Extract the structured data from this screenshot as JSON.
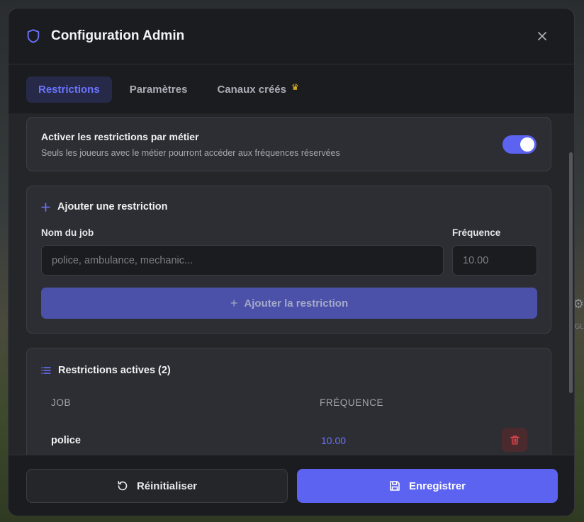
{
  "modal": {
    "title": "Configuration Admin",
    "icons": {
      "title": "shield-icon",
      "close": "close-icon"
    }
  },
  "tabs": [
    {
      "label": "Restrictions",
      "active": true
    },
    {
      "label": "Paramètres",
      "active": false
    },
    {
      "label": "Canaux créés",
      "active": false,
      "badge_icon": "crown-icon"
    }
  ],
  "toggle_card": {
    "title": "Activer les restrictions par métier",
    "description": "Seuls les joueurs avec le métier pourront accéder aux fréquences réservées",
    "enabled": true
  },
  "add_card": {
    "title": "Ajouter une restriction",
    "job_label": "Nom du job",
    "job_placeholder": "police, ambulance, mechanic...",
    "job_value": "",
    "freq_label": "Fréquence",
    "freq_placeholder": "10.00",
    "freq_value": "",
    "submit_label": "Ajouter la restriction"
  },
  "active_card": {
    "title": "Restrictions actives (2)",
    "columns": [
      "JOB",
      "FRÉQUENCE"
    ],
    "rows": [
      {
        "job": "police",
        "frequency": "10.00"
      }
    ]
  },
  "footer": {
    "reset_label": "Réinitialiser",
    "save_label": "Enregistrer"
  },
  "colors": {
    "accent": "#5b63f0",
    "accent_text": "#6b74ff",
    "danger": "#e0444d",
    "crown": "#f5c518"
  }
}
